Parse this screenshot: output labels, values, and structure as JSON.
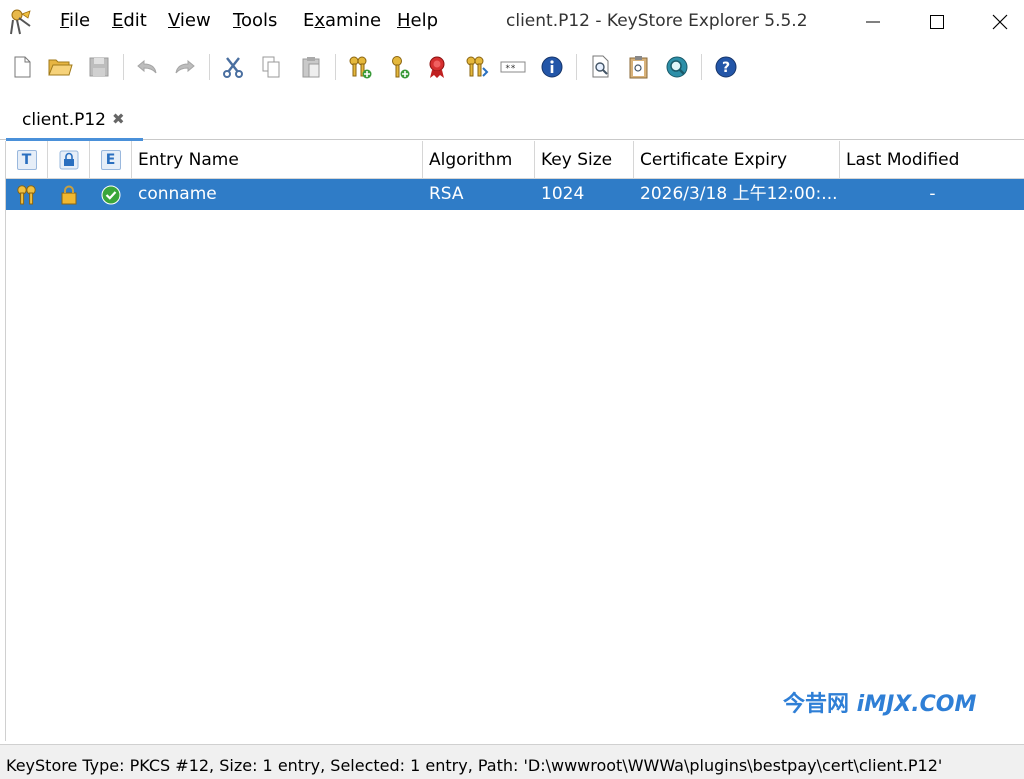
{
  "window": {
    "title": "client.P12 - KeyStore Explorer 5.5.2",
    "app_icon": "keystore-explorer-app-icon"
  },
  "menu": {
    "items": [
      {
        "first": "F",
        "rest": "ile"
      },
      {
        "first": "E",
        "rest": "dit"
      },
      {
        "first": "V",
        "rest": "iew"
      },
      {
        "first": "T",
        "rest": "ools"
      },
      {
        "pre": "E",
        "first": "x",
        "rest": "amine"
      },
      {
        "first": "H",
        "rest": "elp"
      }
    ]
  },
  "toolbar": {
    "icons": [
      "new-icon",
      "open-icon",
      "save-icon",
      "undo-icon",
      "redo-icon",
      "cut-icon",
      "copy-icon",
      "paste-icon",
      "generate-keypair-icon",
      "generate-secret-key-icon",
      "import-trusted-cert-icon",
      "import-keypair-icon",
      "set-password-icon",
      "properties-icon",
      "examine-file-icon",
      "examine-clipboard-icon",
      "examine-ssl-icon",
      "help-icon"
    ]
  },
  "tab": {
    "label": "client.P12",
    "close": "✖"
  },
  "table": {
    "header_badges": [
      "T",
      "E"
    ],
    "columns": [
      "Entry Name",
      "Algorithm",
      "Key Size",
      "Certificate Expiry",
      "Last Modified"
    ],
    "rows": [
      {
        "type_icon": "keypair-icon",
        "lock_icon": "lock-icon",
        "status_icon": "valid-check-icon",
        "entry_name": "conname",
        "algorithm": "RSA",
        "key_size": "1024",
        "certificate_expiry": "2026/3/18 上午12:00:...",
        "last_modified": "-"
      }
    ]
  },
  "watermark": {
    "cn": "今昔网 ",
    "en": "iMJX.COM"
  },
  "status": {
    "text": "KeyStore Type: PKCS #12, Size: 1 entry, Selected: 1 entry, Path: 'D:\\wwwroot\\WWWa\\plugins\\bestpay\\cert\\client.P12'"
  },
  "colors": {
    "selection": "#2f7cc7",
    "tab_accent": "#4a90d9",
    "watermark": "#2f7fd6"
  }
}
